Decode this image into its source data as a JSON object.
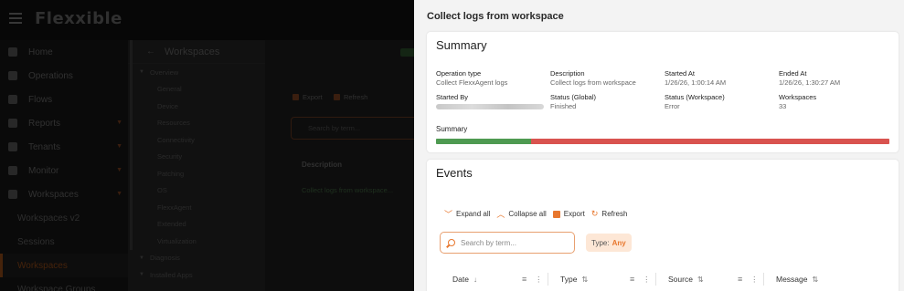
{
  "background": {
    "app_logo": "Flexxible",
    "nav": [
      {
        "label": "Home",
        "icon": "home-icon",
        "chevron": false
      },
      {
        "label": "Operations",
        "icon": "operations-icon",
        "chevron": false
      },
      {
        "label": "Flows",
        "icon": "flows-icon",
        "chevron": false
      },
      {
        "label": "Reports",
        "icon": "reports-icon",
        "chevron": true
      },
      {
        "label": "Tenants",
        "icon": "tenants-icon",
        "chevron": true
      },
      {
        "label": "Monitor",
        "icon": "monitor-icon",
        "chevron": true
      },
      {
        "label": "Workspaces",
        "icon": "workspaces-icon",
        "chevron": true
      }
    ],
    "nav_sub": [
      {
        "label": "Workspaces v2",
        "active": false
      },
      {
        "label": "Sessions",
        "active": false
      },
      {
        "label": "Workspaces",
        "active": true
      },
      {
        "label": "Workspace Groups",
        "active": false
      }
    ],
    "panel_title": "Workspaces",
    "tree": [
      {
        "label": "Overview",
        "top": true
      },
      {
        "label": "General",
        "top": false
      },
      {
        "label": "Device",
        "top": false
      },
      {
        "label": "Resources",
        "top": false
      },
      {
        "label": "Connectivity",
        "top": false
      },
      {
        "label": "Security",
        "top": false
      },
      {
        "label": "Patching",
        "top": false
      },
      {
        "label": "OS",
        "top": false
      },
      {
        "label": "FlexxAgent",
        "top": false
      },
      {
        "label": "Extended",
        "top": false
      },
      {
        "label": "Virtualization",
        "top": false
      },
      {
        "label": "Diagnosis",
        "top": true
      },
      {
        "label": "Installed Apps",
        "top": true
      }
    ],
    "main_export": "Export",
    "main_refresh": "Refresh",
    "main_search_placeholder": "Search by term...",
    "main_col_description": "Description",
    "main_row_link": "Collect logs from workspace..."
  },
  "drawer": {
    "title": "Collect logs from workspace",
    "summary": {
      "title": "Summary",
      "fields": [
        {
          "label": "Operation type",
          "value": "Collect FlexxAgent logs",
          "blurred": false
        },
        {
          "label": "Description",
          "value": "Collect logs from workspace",
          "blurred": false
        },
        {
          "label": "Started At",
          "value": "1/26/26, 1:00:14 AM",
          "blurred": false
        },
        {
          "label": "Ended At",
          "value": "1/26/26, 1:30:27 AM",
          "blurred": false
        },
        {
          "label": "Started By",
          "value": "",
          "blurred": true
        },
        {
          "label": "Status (Global)",
          "value": "Finished",
          "blurred": false
        },
        {
          "label": "Status (Workspace)",
          "value": "Error",
          "blurred": false
        },
        {
          "label": "Workspaces",
          "value": "33",
          "blurred": false
        }
      ],
      "bar_label": "Summary",
      "progress": {
        "success_fraction": 0.21,
        "error_fraction": 0.79,
        "success_color": "#4e9a51",
        "error_color": "#d9534f"
      }
    },
    "events": {
      "title": "Events",
      "toolbar": {
        "expand_all": "Expand all",
        "collapse_all": "Collapse all",
        "export": "Export",
        "refresh": "Refresh"
      },
      "search_placeholder": "Search by term...",
      "type_filter": {
        "label": "Type:",
        "value": "Any"
      },
      "columns": [
        {
          "label": "Date",
          "sort": "↓"
        },
        {
          "label": "Type",
          "sort": "⇅"
        },
        {
          "label": "Source",
          "sort": "⇅"
        },
        {
          "label": "Message",
          "sort": "⇅"
        }
      ]
    },
    "accent_color": "#e8772e"
  }
}
